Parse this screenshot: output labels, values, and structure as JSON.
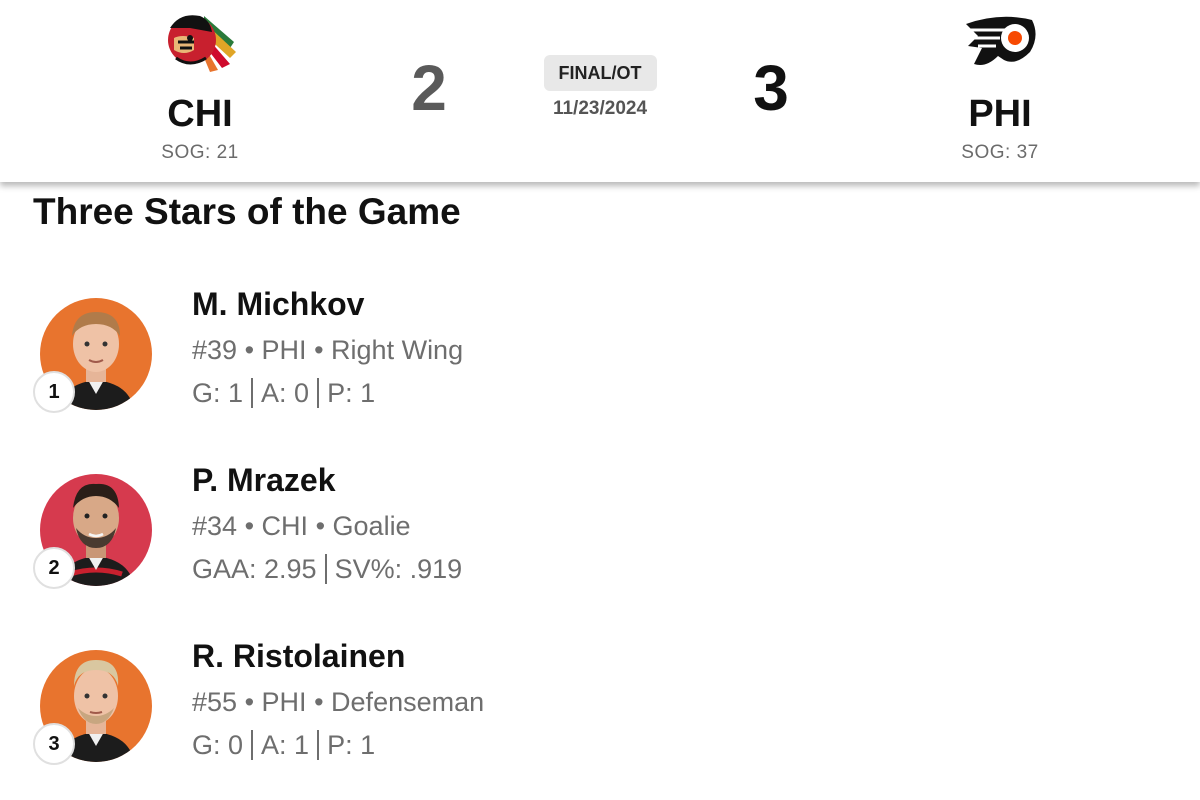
{
  "game": {
    "status": "FINAL/OT",
    "date": "11/23/2024",
    "away": {
      "abbr": "CHI",
      "score": "2",
      "sog_label": "SOG: 21",
      "logo_icon": "blackhawks-logo-icon",
      "colors": {
        "primary": "#CF0A2C",
        "secondary": "#000000"
      }
    },
    "home": {
      "abbr": "PHI",
      "score": "3",
      "sog_label": "SOG: 37",
      "logo_icon": "flyers-logo-icon",
      "colors": {
        "primary": "#F74902",
        "secondary": "#000000"
      }
    }
  },
  "three_stars": {
    "title": "Three Stars of the Game",
    "players": [
      {
        "rank": "1",
        "name": "M. Michkov",
        "number": "#39",
        "team": "PHI",
        "position": "Right Wing",
        "sep": "•",
        "stats": [
          "G: 1",
          "A: 0",
          "P: 1"
        ],
        "avatar_color": "#E8742E"
      },
      {
        "rank": "2",
        "name": "P. Mrazek",
        "number": "#34",
        "team": "CHI",
        "position": "Goalie",
        "sep": "•",
        "stats": [
          "GAA: 2.95",
          "SV%: .919"
        ],
        "avatar_color": "#D63A4E"
      },
      {
        "rank": "3",
        "name": "R. Ristolainen",
        "number": "#55",
        "team": "PHI",
        "position": "Defenseman",
        "sep": "•",
        "stats": [
          "G: 0",
          "A: 1",
          "P: 1"
        ],
        "avatar_color": "#E8742E"
      }
    ]
  }
}
